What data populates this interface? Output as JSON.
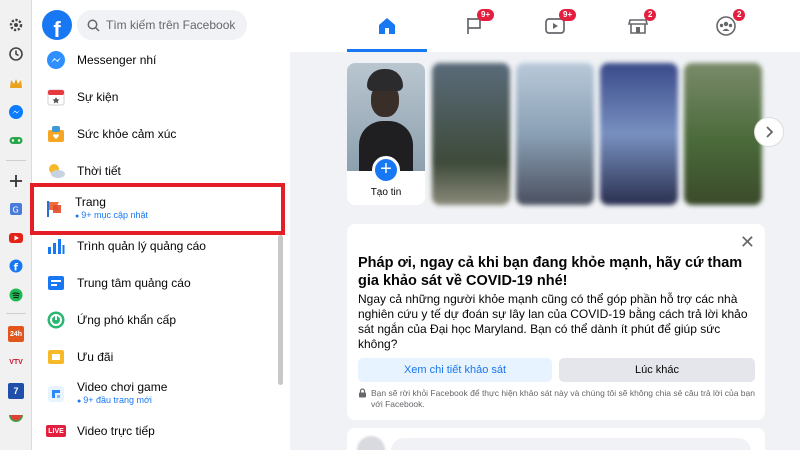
{
  "search": {
    "placeholder": "Tìm kiếm trên Facebook"
  },
  "logo": {
    "letter": "f"
  },
  "sidebar": {
    "items": [
      {
        "label": "Messenger nhí"
      },
      {
        "label": "Sự kiện"
      },
      {
        "label": "Sức khỏe cảm xúc"
      },
      {
        "label": "Thời tiết"
      },
      {
        "label": "Trang",
        "sub": "9+ mục cập nhật"
      },
      {
        "label": "Trình quản lý quảng cáo"
      },
      {
        "label": "Trung tâm quảng cáo"
      },
      {
        "label": "Ứng phó khẩn cấp"
      },
      {
        "label": "Ưu đãi"
      },
      {
        "label": "Video chơi game",
        "sub": "9+ đầu trang mới"
      },
      {
        "label": "Video trực tiếp"
      }
    ]
  },
  "nav": {
    "badges": {
      "pages": "9+",
      "watch": "9+",
      "marketplace": "2",
      "groups": "2"
    }
  },
  "stories": {
    "create_label": "Tạo tin"
  },
  "survey": {
    "title": "Pháp ơi, ngay cả khi bạn đang khỏe mạnh, hãy cứ tham gia khảo sát về COVID-19 nhé!",
    "body": "Ngay cả những người khỏe mạnh cũng có thể góp phần hỗ trợ các nhà nghiên cứu y tế dự đoán sự lây lan của COVID-19 bằng cách trả lời khảo sát ngắn của Đại học Maryland. Bạn có thể dành ít phút để giúp sức không?",
    "primary_button": "Xem chi tiết khảo sát",
    "secondary_button": "Lúc khác",
    "footnote": "Bạn sẽ rời khỏi Facebook để thực hiện khảo sát này và chúng tôi sẽ không chia sẻ câu trả lời của bạn với Facebook.",
    "close_glyph": "✕"
  },
  "extensions": {
    "live_badge": "LIVE",
    "ext_24h": "24h",
    "ext_vtv": "VTV",
    "ext_7": "7"
  },
  "colors": {
    "brand": "#1877f2",
    "highlight": "#e41e26",
    "badge": "#e41e3f"
  }
}
